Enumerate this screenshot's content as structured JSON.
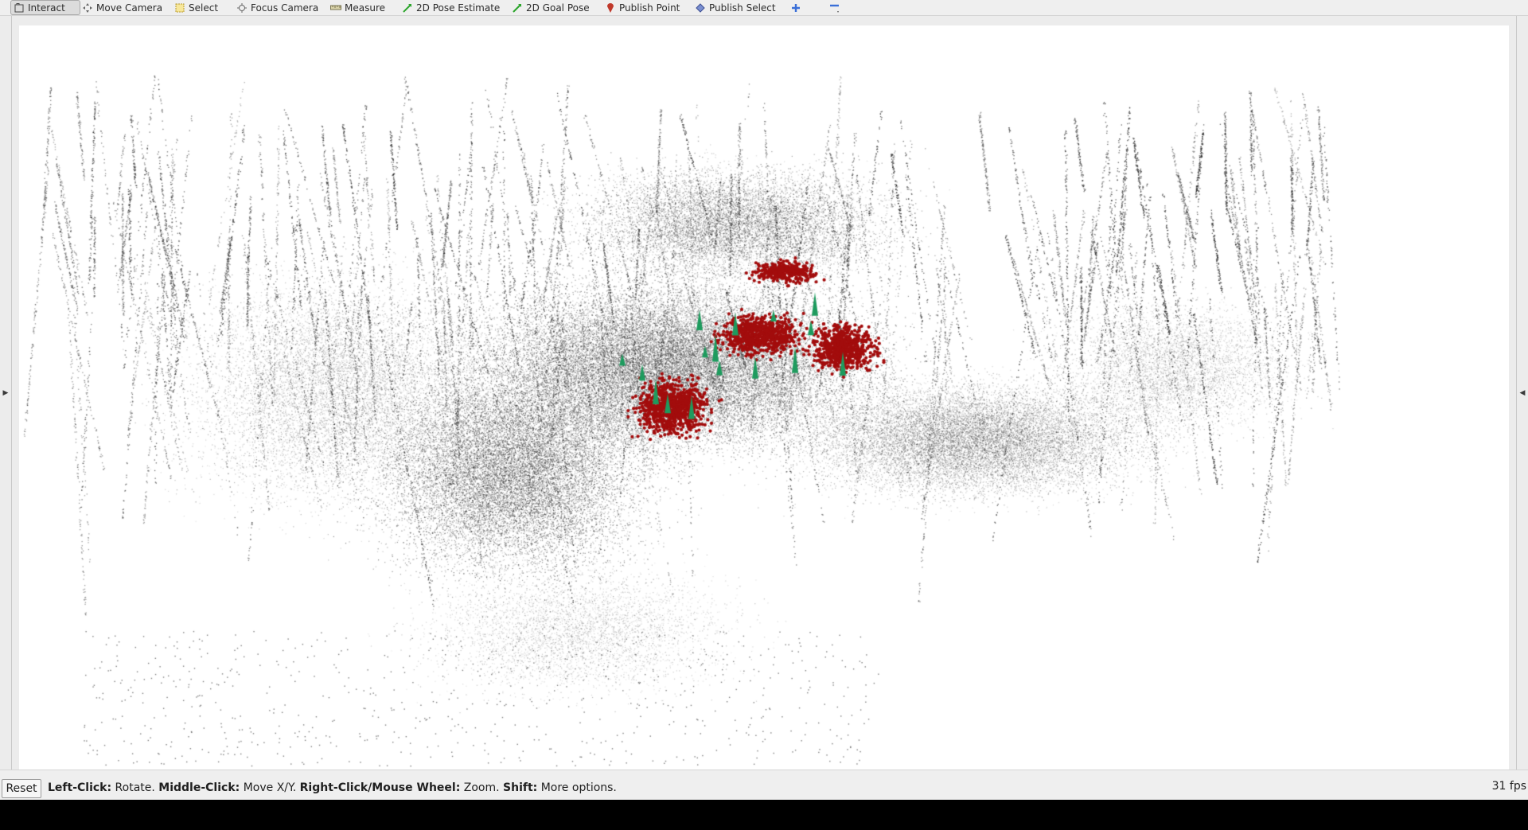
{
  "toolbar": {
    "tools": [
      {
        "label": "Interact",
        "icon": "cursor-icon",
        "active": true
      },
      {
        "label": "Move Camera",
        "icon": "move-camera-icon"
      },
      {
        "label": "Select",
        "icon": "select-icon"
      },
      {
        "label": "Focus Camera",
        "icon": "focus-camera-icon"
      },
      {
        "label": "Measure",
        "icon": "measure-icon"
      },
      {
        "label": "2D Pose Estimate",
        "icon": "pose-estimate-icon"
      },
      {
        "label": "2D Goal Pose",
        "icon": "goal-pose-icon"
      },
      {
        "label": "Publish Point",
        "icon": "publish-point-icon"
      },
      {
        "label": "Publish Select",
        "icon": "publish-select-icon"
      }
    ],
    "add_tool_icon": "plus-icon",
    "remove_tool_icon": "minus-icon"
  },
  "viewport": {
    "background": "#ffffff",
    "point_cloud_color": "#2b2b2b",
    "feature_color": "#a30d0d",
    "marker_color": "#1e9b5e"
  },
  "statusbar": {
    "reset_label": "Reset",
    "hints": [
      {
        "key": "Left-Click:",
        "text": " Rotate. "
      },
      {
        "key": "Middle-Click:",
        "text": " Move X/Y. "
      },
      {
        "key": "Right-Click/Mouse Wheel:",
        "text": " Zoom. "
      },
      {
        "key": "Shift:",
        "text": " More options."
      }
    ],
    "fps": "31 fps"
  },
  "side_handles": {
    "left_icon": "collapse-left-icon",
    "right_icon": "collapse-right-icon"
  }
}
